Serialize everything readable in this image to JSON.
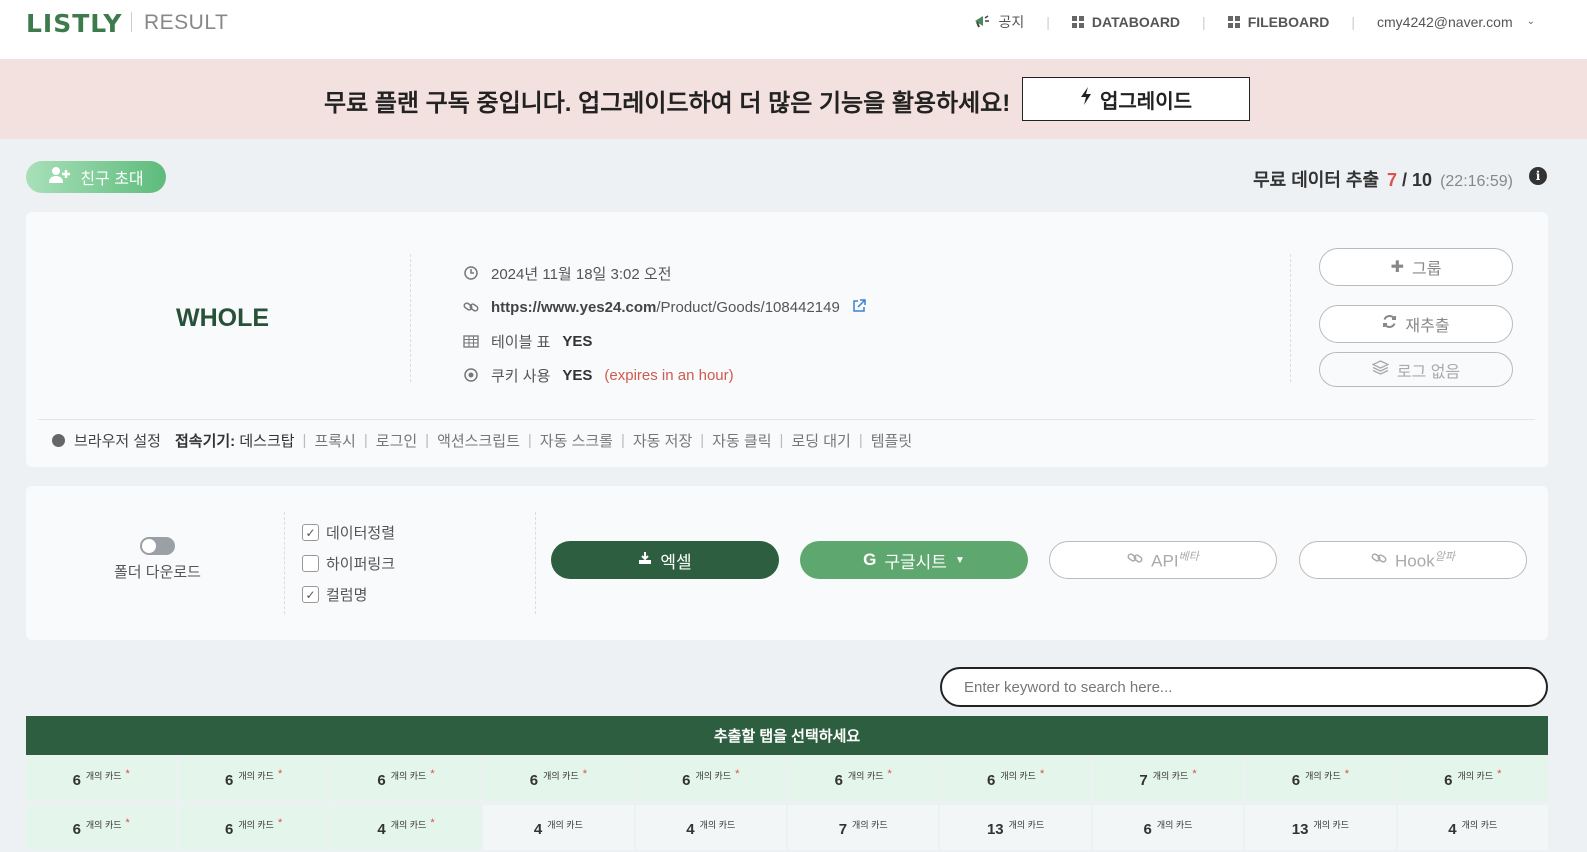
{
  "header": {
    "logo": "LISTLY",
    "subtitle": "RESULT",
    "nav": {
      "notice": "공지",
      "databoard": "DATABOARD",
      "fileboard": "FILEBOARD",
      "account": "cmy4242@naver.com"
    }
  },
  "banner": {
    "message": "무료 플랜 구독 중입니다. 업그레이드하여 더 많은 기능을 활용하세요!",
    "button": "업그레이드"
  },
  "invite": {
    "label": "친구 초대"
  },
  "quota": {
    "label": "무료 데이터 추출",
    "used": "7",
    "total": "/ 10",
    "time": "(22:16:59)"
  },
  "result": {
    "title": "WHOLE",
    "date": "2024년 11월 18일 3:02 오전",
    "url_domain": "https://www.yes24.com",
    "url_path": "/Product/Goods/108442149",
    "table_label": "테이블 표",
    "table_value": "YES",
    "cookie_label": "쿠키 사용",
    "cookie_value": "YES",
    "cookie_expiry": "(expires in an hour)",
    "buttons": {
      "group": "그룹",
      "reextract": "재추출",
      "no_log": "로그 없음"
    }
  },
  "browser_settings": {
    "label": "브라우저 설정",
    "device_label": "접속기기:",
    "device_value": "데스크탑",
    "items": [
      "프록시",
      "로그인",
      "액션스크립트",
      "자동 스크롤",
      "자동 저장",
      "자동 클릭",
      "로딩 대기",
      "템플릿"
    ]
  },
  "export": {
    "folder_download": "폴더 다운로드",
    "options": [
      {
        "label": "데이터정렬",
        "checked": true
      },
      {
        "label": "하이퍼링크",
        "checked": false
      },
      {
        "label": "컬럼명",
        "checked": true
      }
    ],
    "excel": "엑셀",
    "google_sheet": "구글시트",
    "api": "API",
    "api_tag": "베타",
    "hook": "Hook",
    "hook_tag": "알파"
  },
  "search": {
    "placeholder": "Enter keyword to search here..."
  },
  "tabs": {
    "header": "추출할 탭을 선택하세요",
    "unit": "개의 카드",
    "row1": [
      "6",
      "6",
      "6",
      "6",
      "6",
      "6",
      "6",
      "7",
      "6",
      "6"
    ],
    "row2": [
      "6",
      "6",
      "4",
      "4",
      "4",
      "7",
      "13",
      "6",
      "13",
      "4"
    ]
  },
  "colors": {
    "primary": "#2d5e3f",
    "accent": "#5ea86f",
    "banner": "#f2e1df",
    "alert": "#d9534f"
  }
}
